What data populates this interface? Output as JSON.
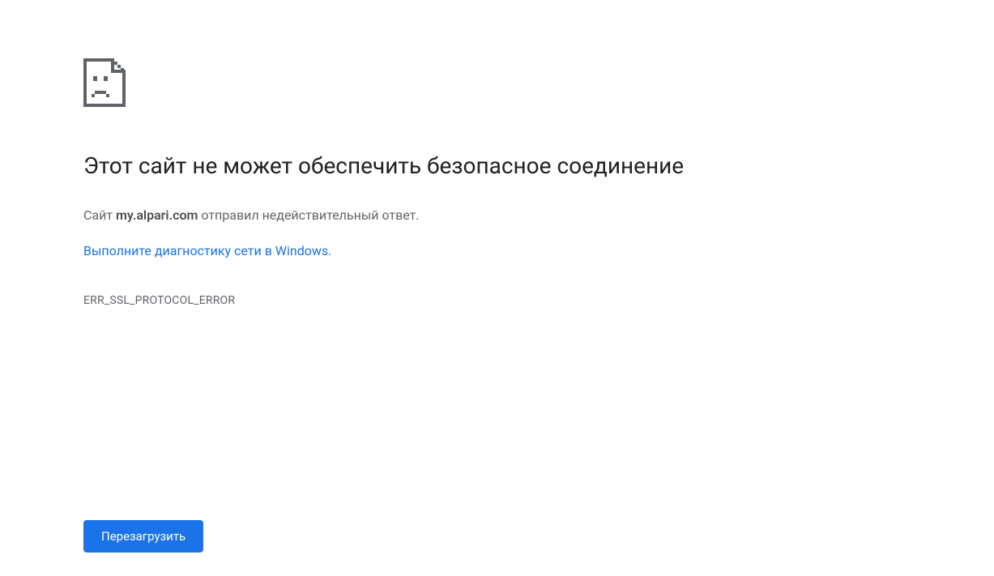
{
  "error": {
    "heading": "Этот сайт не может обеспечить безопасное соединение",
    "description_prefix": "Сайт ",
    "domain": "my.alpari.com",
    "description_suffix": " отправил недействительный ответ.",
    "diagnostic_link": "Выполните диагностику сети в Windows",
    "diagnostic_period": ".",
    "error_code": "ERR_SSL_PROTOCOL_ERROR",
    "reload_button": "Перезагрузить"
  }
}
